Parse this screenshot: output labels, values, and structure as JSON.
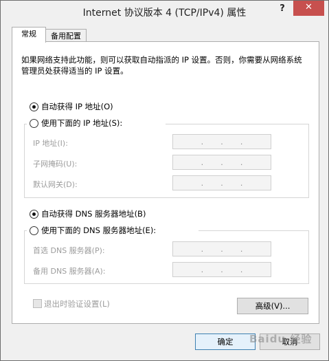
{
  "window": {
    "title": "Internet 协议版本 4 (TCP/IPv4) 属性",
    "help_glyph": "?",
    "close_glyph": "✕"
  },
  "tabs": [
    {
      "label": "常规",
      "active": true
    },
    {
      "label": "备用配置",
      "active": false
    }
  ],
  "description": "如果网络支持此功能，则可以获取自动指派的 IP 设置。否则，你需要从网络系统管理员处获得适当的 IP 设置。",
  "ip": {
    "auto_label": "自动获得 IP 地址(O)",
    "auto_selected": true,
    "manual_label": "使用下面的 IP 地址(S):",
    "manual_selected": false,
    "fields": [
      {
        "label": "IP 地址(I):",
        "value": ". . ."
      },
      {
        "label": "子网掩码(U):",
        "value": ". . ."
      },
      {
        "label": "默认网关(D):",
        "value": ". . ."
      }
    ]
  },
  "dns": {
    "auto_label": "自动获得 DNS 服务器地址(B)",
    "auto_selected": true,
    "manual_label": "使用下面的 DNS 服务器地址(E):",
    "manual_selected": false,
    "fields": [
      {
        "label": "首选 DNS 服务器(P):",
        "value": ". . ."
      },
      {
        "label": "备用 DNS 服务器(A):",
        "value": ". . ."
      }
    ]
  },
  "validate_label": "退出时验证设置(L)",
  "validate_checked": false,
  "buttons": {
    "advanced": "高级(V)...",
    "ok": "确定",
    "cancel": "取消"
  },
  "watermark": "Baidu 经验",
  "colors": {
    "close": "#c7504e",
    "panel": "#ffffff",
    "disabled_text": "#9c9c9c"
  }
}
